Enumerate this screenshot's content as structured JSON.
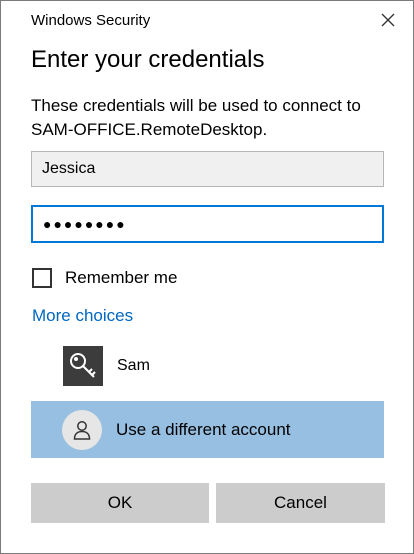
{
  "window": {
    "title": "Windows Security",
    "close_icon": "close-icon"
  },
  "dialog": {
    "heading": "Enter your credentials",
    "description": "These credentials will be used to connect to SAM-OFFICE.RemoteDesktop."
  },
  "form": {
    "username_value": "Jessica",
    "password_value": "●●●●●●●●",
    "remember_label": "Remember me",
    "remember_checked": false
  },
  "choices": {
    "more_choices_label": "More choices",
    "accounts": [
      {
        "name": "Sam",
        "icon": "key-icon"
      },
      {
        "name": "Use a different account",
        "icon": "person-icon",
        "selected": true
      }
    ]
  },
  "buttons": {
    "ok_label": "OK",
    "cancel_label": "Cancel"
  },
  "colors": {
    "accent": "#0078d7",
    "link": "#0067c0",
    "selected_row": "#96bfe2",
    "button_bg": "#cccccc",
    "key_tile": "#3c3c3c"
  }
}
